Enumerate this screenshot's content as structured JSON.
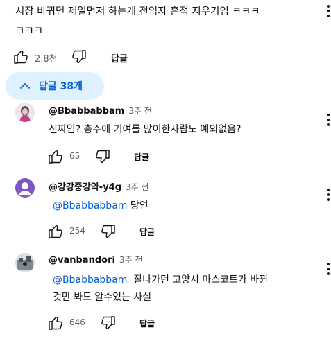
{
  "top_comment": {
    "text_line1": "시장 바뀌면 제일먼저 하는게 전임자 흔적 지우기임 ㅋㅋㅋ",
    "text_line2": "ㅋㅋㅋ",
    "like_count": "2.8천",
    "reply_label": "답글"
  },
  "replies_toggle": {
    "label": "답글 38개",
    "expanded": true
  },
  "replies": [
    {
      "author": "@Bbabbabbam",
      "time": "3주 전",
      "text": "진짜임? 충주에 기여를 많이한사람도 예외없음?",
      "like_count": "65",
      "reply_label": "답글"
    },
    {
      "author": "@강강중강약-y4g",
      "time": "3주 전",
      "mention": "@Bbabbabbam",
      "text": "당연",
      "like_count": "254",
      "reply_label": "답글",
      "avatar_color": "#7e57c2"
    },
    {
      "author": "@vanbandori",
      "time": "3주 전",
      "mention": "@Bbabbabbam",
      "text_line1": "잘나가던 고양시 마스코트가 바뀐",
      "text_line2": "것만 봐도 알수있는 사실",
      "like_count": "646",
      "reply_label": "답글"
    }
  ],
  "colors": {
    "accent": "#065fd4",
    "toggle_bg": "#def1ff",
    "muted": "#606060"
  }
}
